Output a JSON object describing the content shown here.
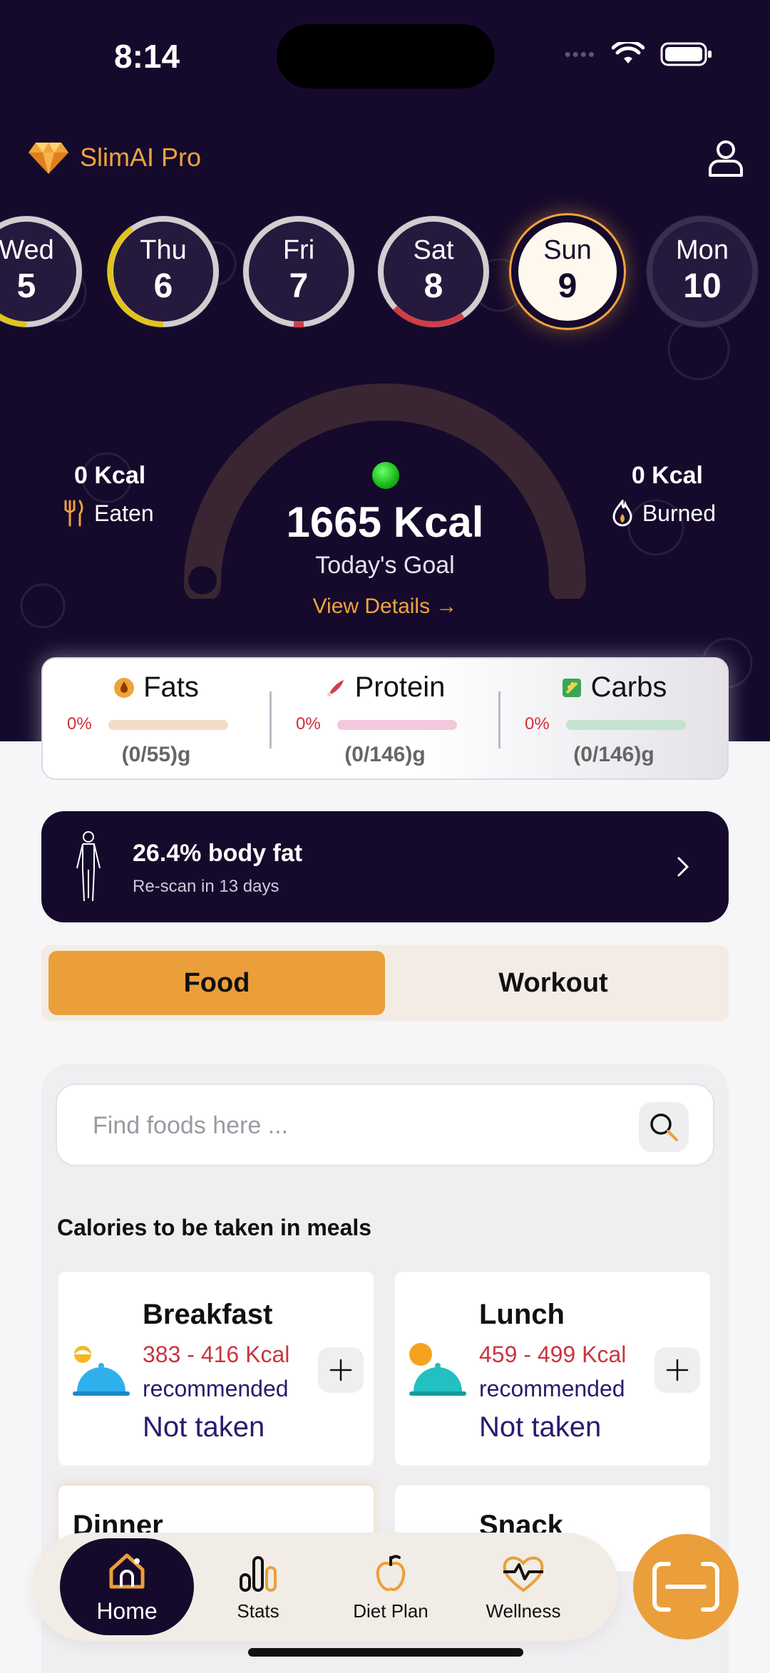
{
  "status_bar": {
    "time": "8:14"
  },
  "header": {
    "brand": "SlimAI Pro"
  },
  "days": [
    {
      "name": "Wed",
      "num": "5"
    },
    {
      "name": "Thu",
      "num": "6"
    },
    {
      "name": "Fri",
      "num": "7"
    },
    {
      "name": "Sat",
      "num": "8"
    },
    {
      "name": "Sun",
      "num": "9"
    },
    {
      "name": "Mon",
      "num": "10"
    }
  ],
  "summary": {
    "eaten_kcal": "0 Kcal",
    "eaten_label": "Eaten",
    "burned_kcal": "0 Kcal",
    "burned_label": "Burned",
    "goal_value": "1665 Kcal",
    "goal_label": "Today's Goal",
    "view_details": "View Details →"
  },
  "macros": [
    {
      "name": "Fats",
      "pct": "0%",
      "amount": "(0/55)g",
      "color": "#f3dcc6"
    },
    {
      "name": "Protein",
      "pct": "0%",
      "amount": "(0/146)g",
      "color": "#f2c8dd"
    },
    {
      "name": "Carbs",
      "pct": "0%",
      "amount": "(0/146)g",
      "color": "#c4e2cf"
    }
  ],
  "bodyfat": {
    "title": "26.4% body fat",
    "subtitle": "Re-scan in 13 days"
  },
  "segments": {
    "food": "Food",
    "workout": "Workout"
  },
  "search": {
    "placeholder": "Find foods here ..."
  },
  "meals_title": "Calories to be taken in meals",
  "meals": [
    {
      "name": "Breakfast",
      "kcal": "383 - 416 Kcal",
      "rec": "recommended",
      "status": "Not taken"
    },
    {
      "name": "Lunch",
      "kcal": "459 - 499 Kcal",
      "rec": "recommended",
      "status": "Not taken"
    },
    {
      "name": "Dinner"
    },
    {
      "name": "Snack"
    }
  ],
  "tabs": [
    {
      "label": "Home",
      "icon": "home-icon"
    },
    {
      "label": "Stats",
      "icon": "stats-icon"
    },
    {
      "label": "Diet Plan",
      "icon": "apple-icon"
    },
    {
      "label": "Wellness",
      "icon": "heart-pulse-icon"
    }
  ],
  "colors": {
    "accent": "#ea9f3a",
    "dark": "#150a2c",
    "red": "#c9353f",
    "navy": "#2b1a6e"
  }
}
